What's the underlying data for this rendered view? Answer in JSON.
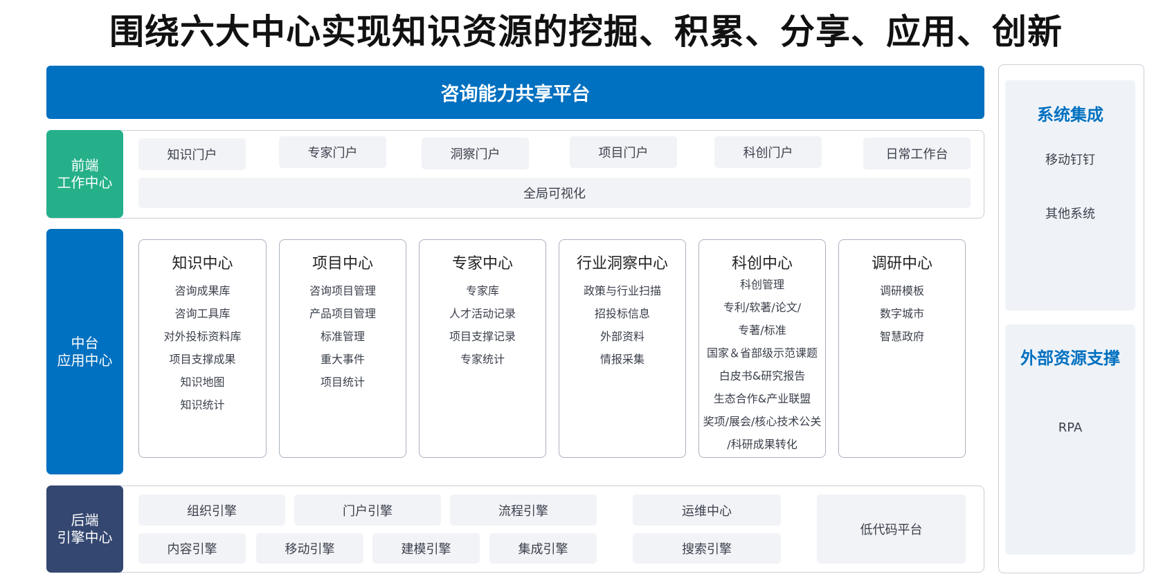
{
  "title": "围绕六大中心实现知识资源的挖掘、积累、分享、应用、创新",
  "banner": "咨询能力共享平台",
  "front": {
    "label_line1": "前端",
    "label_line2": "工作中心",
    "portals": [
      "知识门户",
      "专家门户",
      "洞察门户",
      "项目门户",
      "科创门户",
      "日常工作台"
    ],
    "visualization": "全局可视化"
  },
  "middle": {
    "label_line1": "中台",
    "label_line2": "应用中心",
    "cards": [
      {
        "title": "知识中心",
        "items": [
          "咨询成果库",
          "咨询工具库",
          "对外投标资料库",
          "项目支撑成果",
          "知识地图",
          "知识统计"
        ]
      },
      {
        "title": "项目中心",
        "items": [
          "咨询项目管理",
          "产品项目管理",
          "标准管理",
          "重大事件",
          "项目统计"
        ]
      },
      {
        "title": "专家中心",
        "items": [
          "专家库",
          "人才活动记录",
          "项目支撑记录",
          "专家统计"
        ]
      },
      {
        "title": "行业洞察中心",
        "items": [
          "政策与行业扫描",
          "招投标信息",
          "外部资料",
          "情报采集"
        ]
      },
      {
        "title": "科创中心",
        "items": [
          "科创管理",
          "专利/软著/论文/",
          "专著/标准",
          "国家＆省部级示范课题",
          "白皮书&研究报告",
          "生态合作&产业联盟",
          "奖项/展会/核心技术公关",
          "/科研成果转化"
        ]
      },
      {
        "title": "调研中心",
        "items": [
          "调研模板",
          "数字城市",
          "智慧政府"
        ]
      }
    ]
  },
  "back": {
    "label_line1": "后端",
    "label_line2": "引擎中心",
    "row1": [
      "组织引擎",
      "门户引擎",
      "流程引擎"
    ],
    "row2": [
      "内容引擎",
      "移动引擎",
      "建模引擎",
      "集成引擎"
    ],
    "ops": [
      "运维中心",
      "搜索引擎"
    ],
    "lowcode": "低代码平台"
  },
  "side": {
    "integration": {
      "title": "系统集成",
      "items": [
        "移动钉钉",
        "其他系统"
      ]
    },
    "external": {
      "title": "外部资源支撑",
      "items": [
        "RPA"
      ]
    }
  },
  "colors": {
    "brand_blue": "#0070c0",
    "front_green": "#25b08a",
    "back_navy": "#344770",
    "pill_bg": "#f2f3f7",
    "side_bg": "#eff3f8"
  }
}
